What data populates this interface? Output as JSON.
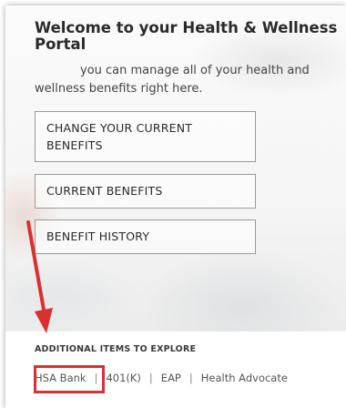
{
  "portal": {
    "title": "Welcome to your Health & Wellness Portal",
    "intro": "you can manage all of your health and wellness benefits right here."
  },
  "buttons": {
    "change_benefits": "CHANGE YOUR CURRENT BENEFITS",
    "current_benefits": "CURRENT BENEFITS",
    "benefit_history": "BENEFIT HISTORY"
  },
  "additional": {
    "label": "ADDITIONAL ITEMS TO EXPLORE",
    "links": [
      "HSA Bank",
      "401(K)",
      "EAP",
      "Health Advocate"
    ],
    "separator": "|"
  },
  "colors": {
    "annotation": "#d93030"
  }
}
